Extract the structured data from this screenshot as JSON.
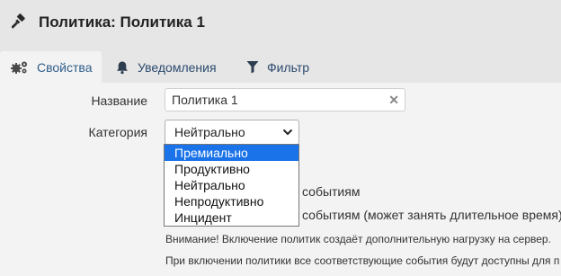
{
  "header": {
    "title": "Политика: Политика 1",
    "icon": "gavel-icon"
  },
  "tabs": [
    {
      "label": "Свойства",
      "icon": "gears-icon",
      "active": true
    },
    {
      "label": "Уведомления",
      "icon": "bell-icon",
      "active": false
    },
    {
      "label": "Фильтр",
      "icon": "filter-icon",
      "active": false
    }
  ],
  "form": {
    "name_label": "Название",
    "name_value": "Политика 1",
    "clear_icon": "close-icon",
    "category_label": "Категория",
    "category_value": "Нейтрально",
    "category_options": [
      "Премиально",
      "Продуктивно",
      "Нейтрально",
      "Непродуктивно",
      "Инцидент"
    ],
    "highlighted_option": "Премиально"
  },
  "options_text": {
    "line1_tail": "событиям",
    "line2_tail": "событиям (может занять длительное время)"
  },
  "notes": {
    "warning": "Внимание! Включение политик создаёт дополнительную нагрузку на сервер.",
    "info": "При включении политики все соответствующие события будут доступны для п"
  },
  "colors": {
    "accent": "#1a73e8",
    "tab_text": "#2c4b6e"
  }
}
